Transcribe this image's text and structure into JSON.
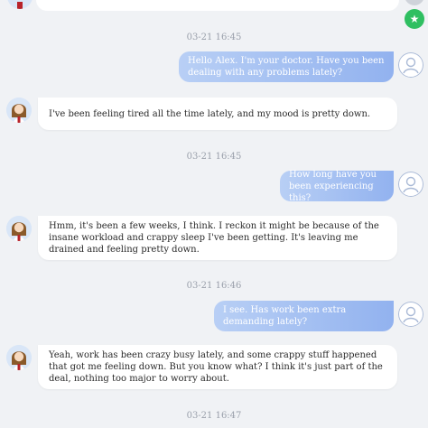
{
  "conversation": {
    "timestamps": [
      "03-21 16:45",
      "03-21 16:45",
      "03-21 16:46",
      "03-21 16:47"
    ],
    "doctor_messages": [
      "Hello Alex. I'm your doctor. Have you been dealing with any problems lately?",
      "How long have you been experiencing this?",
      "I see. Has work been extra demanding lately?"
    ],
    "patient_messages": [
      "I've been feeling tired all the time lately, and my mood is pretty down.",
      "Hmm, it's been a few weeks, I think. I reckon it might be because of the insane workload and crappy sleep I've been getting. It's leaving me drained and feeling pretty down.",
      "Yeah, work has been crazy busy lately, and some crappy stuff happened that got me feeling down. But you know what? I think it's just part of the deal, nothing too major to worry about."
    ]
  },
  "floating_button": {
    "icon": "star-icon",
    "glyph": "★",
    "color": "#2fbf61"
  },
  "colors": {
    "background": "#f0f2f5",
    "doctor_bubble_start": "#b8cff5",
    "doctor_bubble_end": "#92b2ef",
    "patient_bubble": "#ffffff",
    "timestamp": "#9aa0ab"
  }
}
